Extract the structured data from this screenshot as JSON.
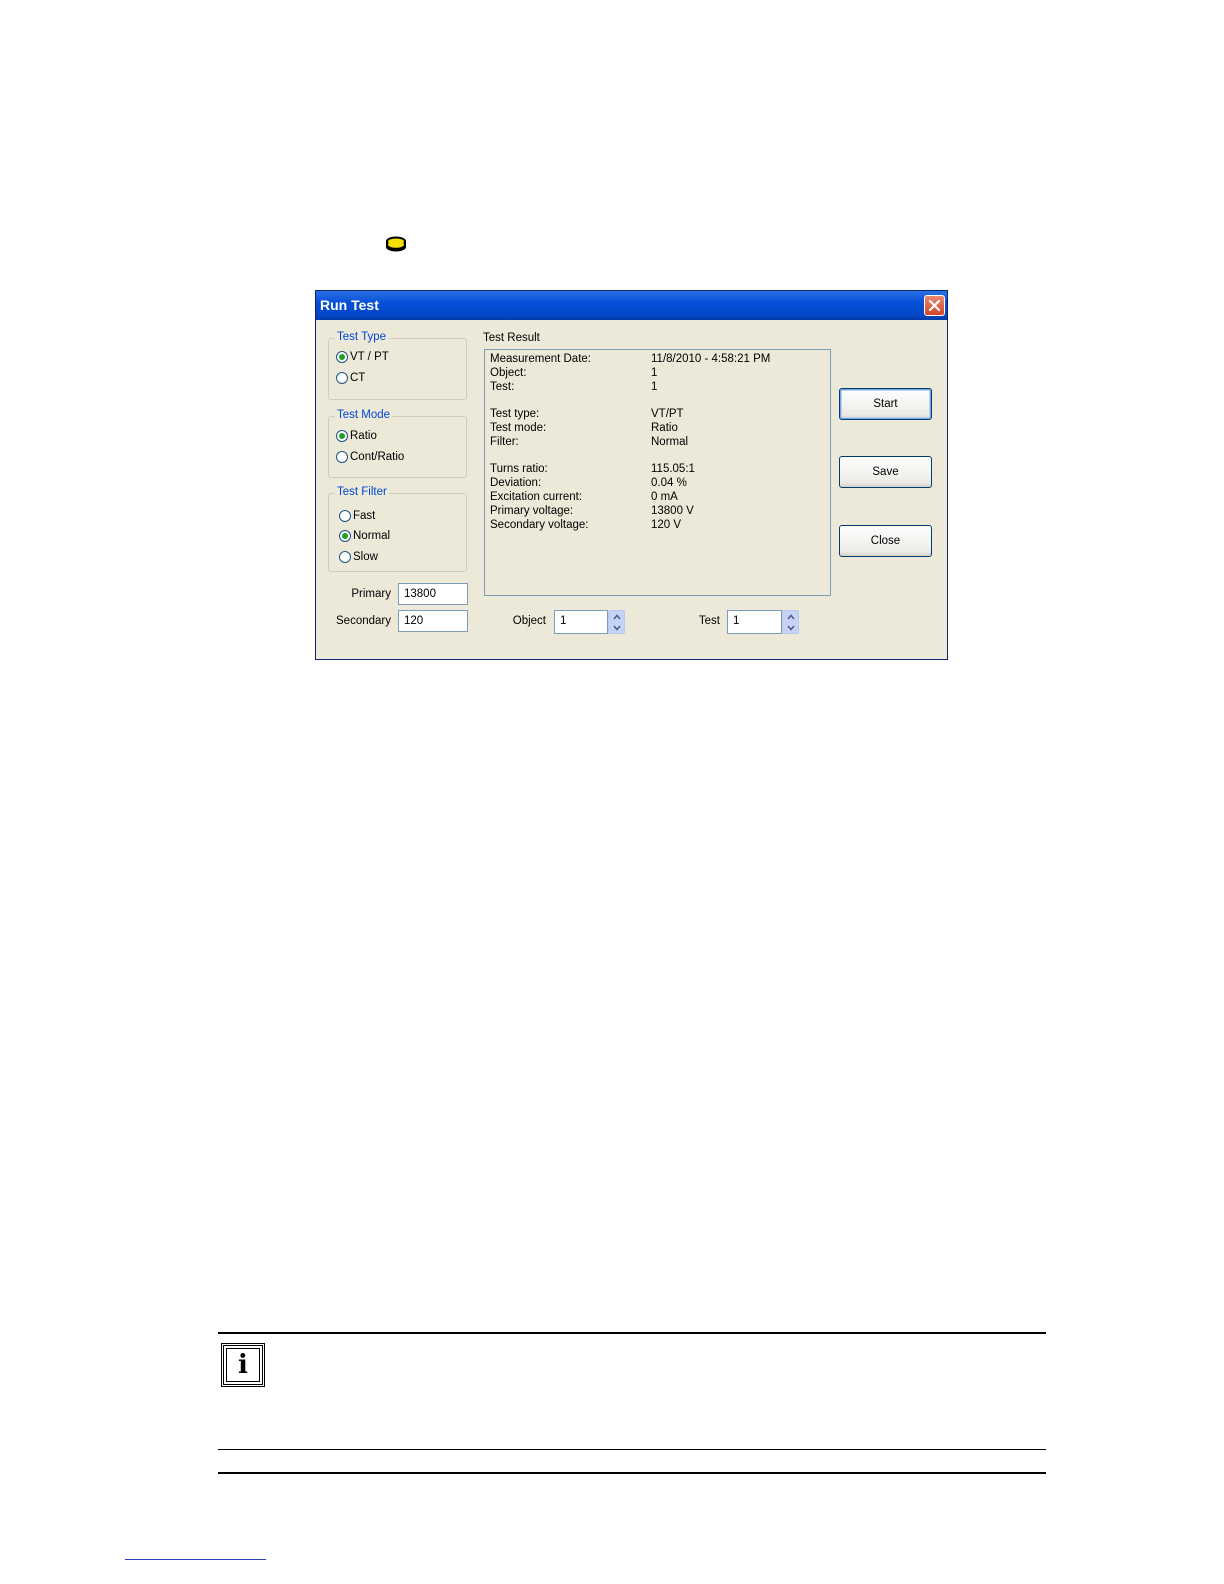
{
  "dialog": {
    "title": "Run Test",
    "test_type": {
      "label": "Test Type",
      "options": [
        "VT / PT",
        "CT"
      ],
      "selected": "VT / PT"
    },
    "test_mode": {
      "label": "Test Mode",
      "options": [
        "Ratio",
        "Cont/Ratio"
      ],
      "selected": "Ratio"
    },
    "test_filter": {
      "label": "Test Filter",
      "options": [
        "Fast",
        "Normal",
        "Slow"
      ],
      "selected": "Normal"
    },
    "primary": {
      "label": "Primary",
      "value": "13800"
    },
    "secondary": {
      "label": "Secondary",
      "value": "120"
    },
    "result": {
      "label": "Test Result",
      "rows": [
        {
          "key": "Measurement Date:",
          "value": "11/8/2010 - 4:58:21 PM"
        },
        {
          "key": "Object:",
          "value": "1"
        },
        {
          "key": "Test:",
          "value": "1"
        },
        {
          "key": "Test type:",
          "value": "VT/PT"
        },
        {
          "key": "Test mode:",
          "value": "Ratio"
        },
        {
          "key": "Filter:",
          "value": "Normal"
        },
        {
          "key": "Turns ratio:",
          "value": "115.05:1"
        },
        {
          "key": "Deviation:",
          "value": "0.04 %"
        },
        {
          "key": "Excitation current:",
          "value": "0 mA"
        },
        {
          "key": "Primary voltage:",
          "value": "13800 V"
        },
        {
          "key": "Secondary voltage:",
          "value": "120 V"
        }
      ]
    },
    "object_spin": {
      "label": "Object",
      "value": "1"
    },
    "test_spin": {
      "label": "Test",
      "value": "1"
    },
    "buttons": {
      "start": "Start",
      "save": "Save",
      "close": "Close"
    }
  },
  "icons": {
    "database": "database-icon",
    "info": "info-icon",
    "close": "close-icon"
  },
  "note": {
    "icon_glyph": "i"
  }
}
